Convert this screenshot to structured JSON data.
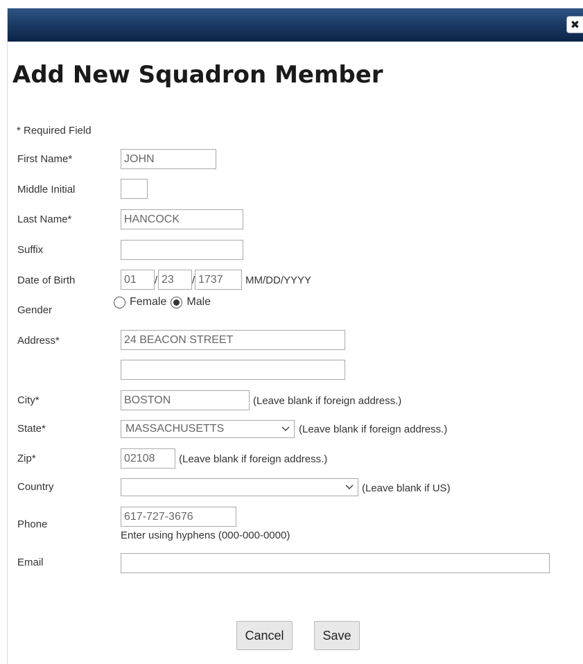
{
  "dialog": {
    "close_icon": "close-icon",
    "title": "Add New Squadron Member",
    "required_note": "* Required Field"
  },
  "form": {
    "first_name": {
      "label": "First Name*",
      "value": "JOHN"
    },
    "middle_initial": {
      "label": "Middle Initial",
      "value": ""
    },
    "last_name": {
      "label": "Last Name*",
      "value": "HANCOCK"
    },
    "suffix": {
      "label": "Suffix",
      "value": ""
    },
    "dob": {
      "label": "Date of Birth",
      "month": "01",
      "day": "23",
      "year": "1737",
      "separator": "/",
      "format_hint": "MM/DD/YYYY"
    },
    "gender": {
      "label": "Gender",
      "options": [
        "Female",
        "Male"
      ],
      "selected": "Male"
    },
    "address": {
      "label": "Address*",
      "line1": "24 BEACON STREET",
      "line2": ""
    },
    "city": {
      "label": "City*",
      "value": "BOSTON",
      "hint": "(Leave blank if foreign address.)"
    },
    "state": {
      "label": "State*",
      "value": "MASSACHUSETTS",
      "hint": "(Leave blank if foreign address.)"
    },
    "zip": {
      "label": "Zip*",
      "value": "02108",
      "hint": "(Leave blank if foreign address.)"
    },
    "country": {
      "label": "Country",
      "value": "",
      "hint": "(Leave blank if US)"
    },
    "phone": {
      "label": "Phone",
      "value": "617-727-3676",
      "hint": "Enter using hyphens (000-000-0000)"
    },
    "email": {
      "label": "Email",
      "value": ""
    }
  },
  "buttons": {
    "cancel": "Cancel",
    "save": "Save"
  },
  "colors": {
    "titlebar_top": "#2f5585",
    "titlebar_bottom": "#0b2448"
  }
}
